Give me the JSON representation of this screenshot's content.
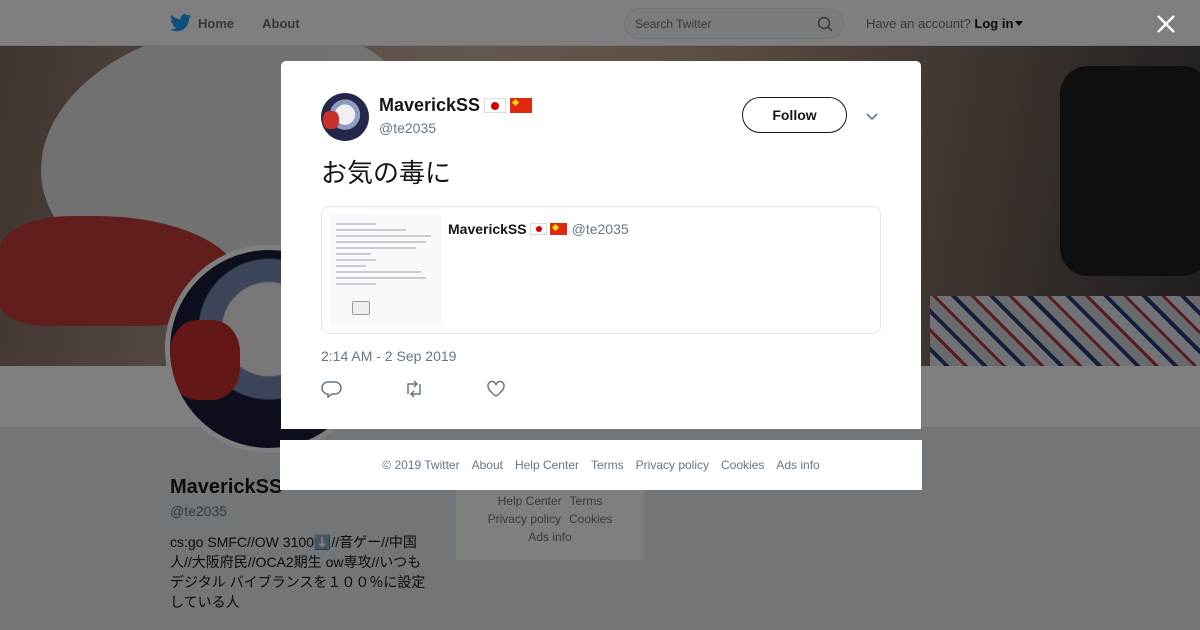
{
  "nav": {
    "home_label": "Home",
    "about_label": "About",
    "search_placeholder": "Search Twitter",
    "account_prompt": "Have an account?",
    "login_label": "Log in"
  },
  "profile": {
    "name": "MaverickSS",
    "handle": "@te2035",
    "bio": "cs:go SMFC//OW 3100⬇️//音ゲー//中国人//大阪府民//OCA2期生 ow専攻//いつもデジタル バイブランスを１００％に設定している人"
  },
  "side_footer": {
    "links": [
      "Help Center",
      "Terms",
      "Privacy policy",
      "Cookies",
      "Ads info"
    ]
  },
  "tweet": {
    "author_name": "MaverickSS",
    "author_handle": "@te2035",
    "follow_label": "Follow",
    "text": "お気の毒に",
    "quote": {
      "author_name": "MaverickSS",
      "author_handle": "@te2035"
    },
    "timestamp": "2:14 AM - 2 Sep 2019"
  },
  "footer": {
    "copyright": "© 2019 Twitter",
    "links": [
      "About",
      "Help Center",
      "Terms",
      "Privacy policy",
      "Cookies",
      "Ads info"
    ]
  },
  "colors": {
    "twitter_blue": "#1da1f2",
    "secondary_text": "#657786",
    "primary_text": "#14171a"
  },
  "icons": [
    "twitter-bird-icon",
    "search-icon",
    "close-icon",
    "chevron-down-icon",
    "reply-icon",
    "retweet-icon",
    "like-icon",
    "flag-japan-icon",
    "flag-china-icon"
  ]
}
